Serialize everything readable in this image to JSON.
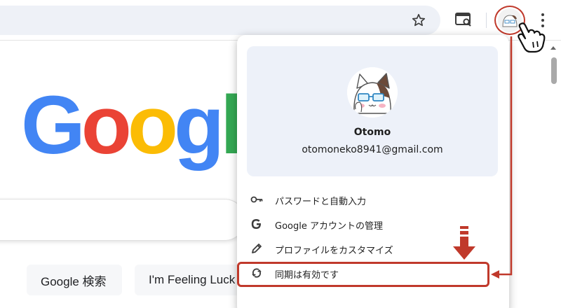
{
  "toolbar": {
    "icons": [
      "star-icon",
      "cast-icon",
      "profile-avatar",
      "more-icon"
    ]
  },
  "page": {
    "logo_text": "Google",
    "search_button": "Google 検索",
    "lucky_button": "I'm Feeling Luck"
  },
  "menu": {
    "profile_name": "Otomo",
    "profile_email": "otomoneko8941@gmail.com",
    "items": [
      {
        "label": "パスワードと自動入力",
        "icon": "key-icon"
      },
      {
        "label": "Google アカウントの管理",
        "icon": "google-g-icon"
      },
      {
        "label": "プロファイルをカスタマイズ",
        "icon": "pencil-icon"
      },
      {
        "label": "同期は有効です",
        "icon": "sync-icon"
      }
    ]
  },
  "colors": {
    "annotation": "#c0392b",
    "google_blue": "#4285f4",
    "google_red": "#ea4335",
    "google_yellow": "#fbbc05",
    "google_green": "#34a853"
  }
}
